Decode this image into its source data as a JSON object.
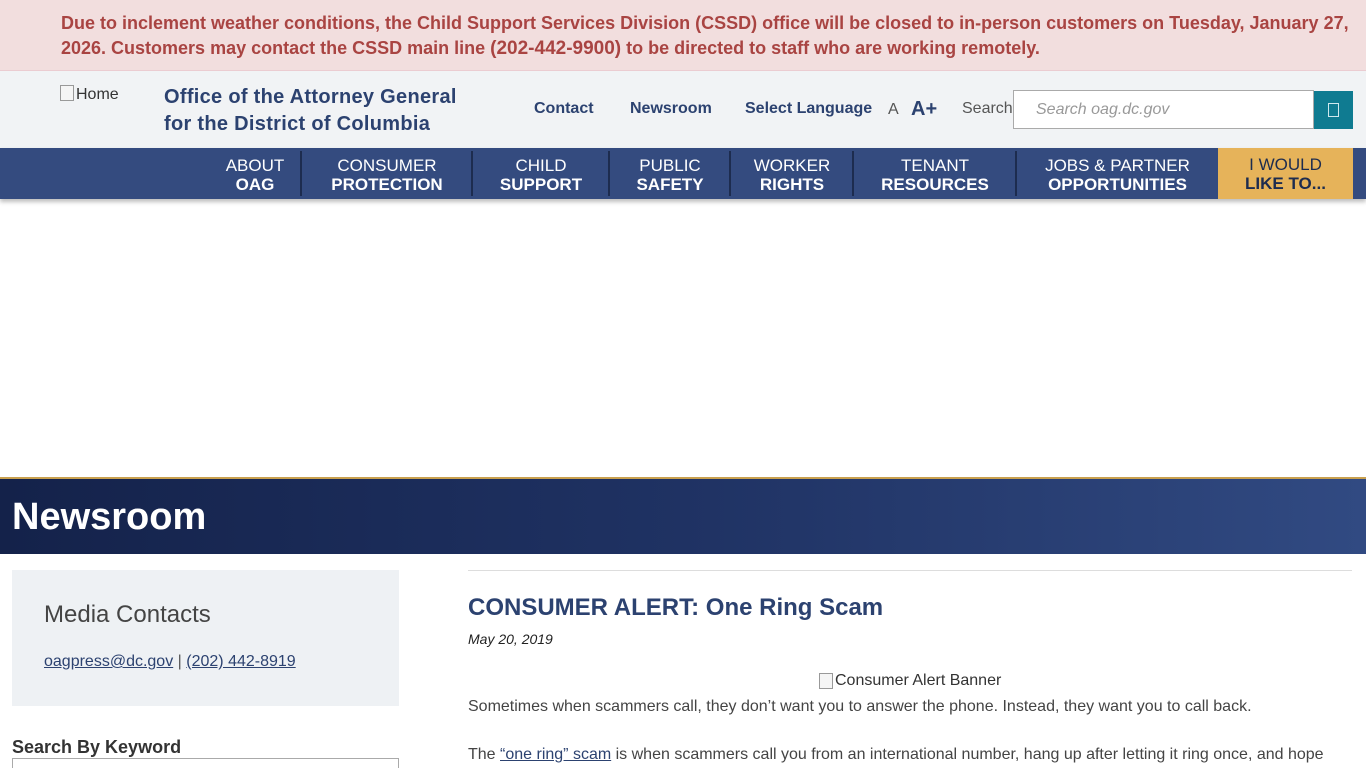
{
  "alert": {
    "text_before": "Due to inclement weather conditions, the Child Support Services Division (CSSD) office will be closed to in-person customers on Tuesday, January 27, 2026. Customers may contact the CSSD main line ",
    "phone": "(202-442-9900)",
    "text_after": " to be directed to staff who are working remotely."
  },
  "header": {
    "logo_alt": "Home",
    "title_line1": "Office of the Attorney General",
    "title_line2": "for the District of Columbia",
    "links": {
      "contact": "Contact",
      "newsroom": "Newsroom",
      "language": "Select Language"
    },
    "font_small": "A",
    "font_large": "A+",
    "search_label": "Search",
    "search_placeholder": "Search oag.dc.gov"
  },
  "nav": {
    "items": [
      {
        "line1": "ABOUT",
        "line2": "OAG"
      },
      {
        "line1": "CONSUMER",
        "line2": "PROTECTION"
      },
      {
        "line1": "CHILD",
        "line2": "SUPPORT"
      },
      {
        "line1": "PUBLIC",
        "line2": "SAFETY"
      },
      {
        "line1": "WORKER",
        "line2": "RIGHTS"
      },
      {
        "line1": "TENANT",
        "line2": "RESOURCES"
      },
      {
        "line1": "JOBS & PARTNER",
        "line2": "OPPORTUNITIES"
      }
    ],
    "cta": {
      "line1": "I WOULD",
      "line2": "LIKE TO..."
    }
  },
  "hero": {
    "title": "Newsroom"
  },
  "sidebar": {
    "media_title": "Media Contacts",
    "email": "oagpress@dc.gov",
    "separator": "|",
    "phone": "(202) 442-8919",
    "keyword_label": "Search By Keyword"
  },
  "article": {
    "title": "CONSUMER ALERT: One Ring Scam",
    "date": "May 20, 2019",
    "banner_alt": "Consumer Alert Banner",
    "p1": "Sometimes when scammers call, they don’t want you to answer the phone. Instead, they want you to call back.",
    "p2_before": "The ",
    "p2_link": "“one ring” scam",
    "p2_after": " is when scammers call you from an international number, hang up after letting it ring once, and hope"
  },
  "colors": {
    "brand_navy": "#2c4270",
    "nav_bg": "#344b7f",
    "cta_gold": "#e6b35a",
    "alert_text": "#a94442",
    "alert_bg": "#f2dede",
    "search_button": "#0f7b91"
  }
}
